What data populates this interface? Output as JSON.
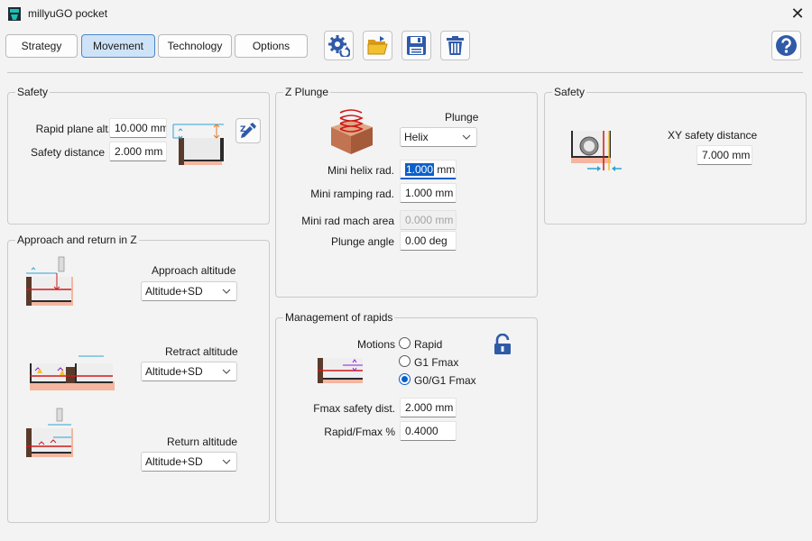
{
  "window": {
    "title": "millyuGO pocket",
    "close_glyph": "✕"
  },
  "tabs": [
    {
      "label": "Strategy",
      "active": false
    },
    {
      "label": "Movement",
      "active": true
    },
    {
      "label": "Technology",
      "active": false
    },
    {
      "label": "Options",
      "active": false
    }
  ],
  "toolbar": {
    "buttons": [
      {
        "icon": "gear-refresh-icon"
      },
      {
        "icon": "open-folder-icon"
      },
      {
        "icon": "save-icon"
      },
      {
        "icon": "trash-icon"
      },
      {
        "icon": "help-icon"
      }
    ],
    "accent_color": "#2f5aa8"
  },
  "safety_left": {
    "title": "Safety",
    "rapid_plane_label": "Rapid plane alt.",
    "rapid_plane_value": "10.000 mm",
    "safety_distance_label": "Safety distance",
    "safety_distance_value": "2.000 mm",
    "pick_icon": "eyedropper-icon"
  },
  "z_plunge": {
    "title": "Z Plunge",
    "plunge_label": "Plunge",
    "plunge_value": "Helix",
    "mini_helix_label": "Mini helix rad.",
    "mini_helix_value": "1.000",
    "mini_helix_unit": "mm",
    "mini_ramping_label": "Mini ramping rad.",
    "mini_ramping_value": "1.000 mm",
    "mini_rad_mach_label": "Mini rad mach area",
    "mini_rad_mach_value": "0.000 mm",
    "plunge_angle_label": "Plunge angle",
    "plunge_angle_value": "0.00 deg"
  },
  "safety_right": {
    "title": "Safety",
    "xy_label": "XY safety distance",
    "xy_value": "7.000 mm"
  },
  "approach": {
    "title": "Approach and return in Z",
    "approach_label": "Approach altitude",
    "approach_value": "Altitude+SD",
    "retract_label": "Retract altitude",
    "retract_value": "Altitude+SD",
    "return_label": "Return altitude",
    "return_value": "Altitude+SD"
  },
  "rapids": {
    "title": "Management of rapids",
    "motions_label": "Motions",
    "options": [
      {
        "label": "Rapid",
        "checked": false
      },
      {
        "label": "G1 Fmax",
        "checked": false
      },
      {
        "label": "G0/G1 Fmax",
        "checked": true
      }
    ],
    "fmax_label": "Fmax safety dist.",
    "fmax_value": "2.000 mm",
    "ratio_label": "Rapid/Fmax %",
    "ratio_value": "0.4000",
    "lock_icon": "unlock-icon"
  }
}
